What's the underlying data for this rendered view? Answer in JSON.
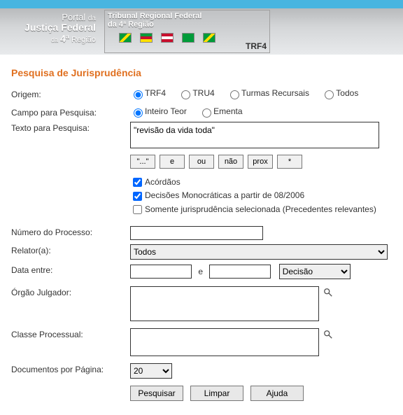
{
  "header": {
    "portal_line1_a": "Portal",
    "portal_line1_b": "da",
    "portal_line2": "Justiça Federal",
    "portal_line3_a": "da",
    "portal_line3_b": "4ª",
    "portal_line3_c": "Região",
    "tribunal_line1": "Tribunal Regional Federal",
    "tribunal_line2": "da 4ª Região",
    "trf4_label": "TRF4"
  },
  "page_title": "Pesquisa de Jurisprudência",
  "labels": {
    "origem": "Origem:",
    "campo_pesquisa": "Campo para Pesquisa:",
    "texto_pesquisa": "Texto para Pesquisa:",
    "numero_processo": "Número do Processo:",
    "relator": "Relator(a):",
    "data_entre": "Data entre:",
    "data_e": "e",
    "orgao_julgador": "Órgão Julgador:",
    "classe_processual": "Classe Processual:",
    "docs_por_pagina": "Documentos por Página:"
  },
  "origem": {
    "options": [
      {
        "label": "TRF4",
        "checked": true
      },
      {
        "label": "TRU4",
        "checked": false
      },
      {
        "label": "Turmas Recursais",
        "checked": false
      },
      {
        "label": "Todos",
        "checked": false
      }
    ]
  },
  "campo_pesquisa": {
    "options": [
      {
        "label": "Inteiro Teor",
        "checked": true
      },
      {
        "label": "Ementa",
        "checked": false
      }
    ]
  },
  "texto_pesquisa": "\"revisão da vida toda\"",
  "op_buttons": [
    "\"...\"",
    "e",
    "ou",
    "não",
    "prox",
    "*"
  ],
  "checkboxes": {
    "acordaos": {
      "label": "Acórdãos",
      "checked": true
    },
    "decisoes": {
      "label": "Decisões Monocráticas a partir de 08/2006",
      "checked": true
    },
    "somente": {
      "label": "Somente jurisprudência selecionada (Precedentes relevantes)",
      "checked": false
    }
  },
  "numero_processo": "",
  "relator": {
    "selected": "Todos",
    "options": [
      "Todos"
    ]
  },
  "data_entre": {
    "start": "",
    "end": "",
    "type_selected": "Decisão",
    "type_options": [
      "Decisão"
    ]
  },
  "orgao_julgador": "",
  "classe_processual": "",
  "docs_por_pagina": {
    "selected": "20",
    "options": [
      "20"
    ]
  },
  "actions": {
    "pesquisar": "Pesquisar",
    "limpar": "Limpar",
    "ajuda": "Ajuda"
  }
}
